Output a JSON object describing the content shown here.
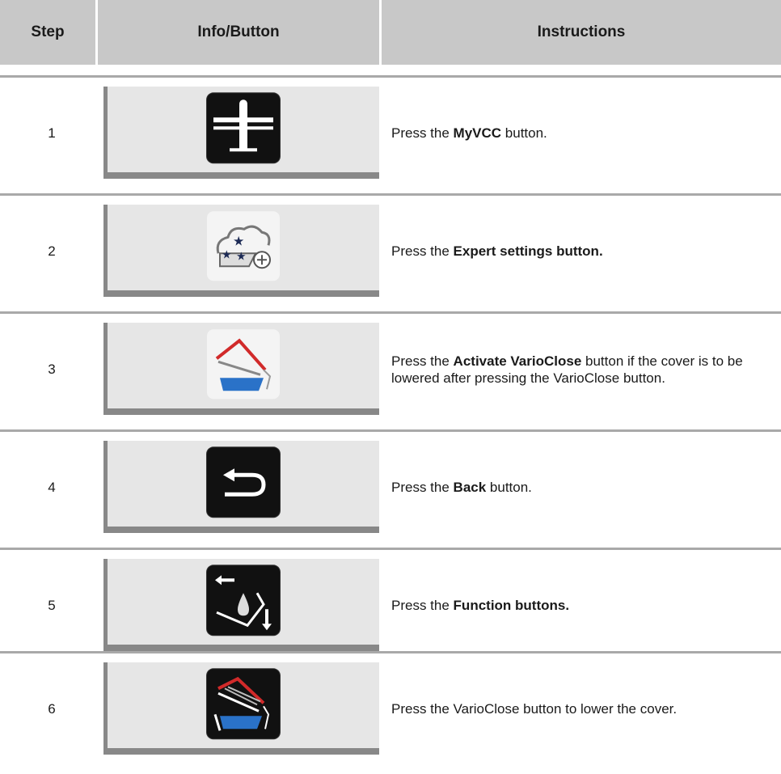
{
  "header": {
    "step": "Step",
    "info": "Info/Button",
    "instructions": "Instructions"
  },
  "rows": [
    {
      "step": "1",
      "icon": "myvcc-icon",
      "pre": "Press the ",
      "bold": "MyVCC",
      "post": " button."
    },
    {
      "step": "2",
      "icon": "expert-settings-icon",
      "pre": "Press the ",
      "bold": "Expert settings button.",
      "post": ""
    },
    {
      "step": "3",
      "icon": "activate-varioclose-icon",
      "pre": "Press the ",
      "bold": "Activate VarioClose",
      "post": " button if the cover is to be lowered after pressing the VarioClose button."
    },
    {
      "step": "4",
      "icon": "back-icon",
      "pre": "Press the ",
      "bold": "Back",
      "post": " button."
    },
    {
      "step": "5",
      "icon": "function-buttons-icon",
      "pre": "Press the ",
      "bold": "Function buttons.",
      "post": ""
    },
    {
      "step": "6",
      "icon": "varioclose-icon",
      "pre": "Press the VarioClose button to lower the cover.",
      "bold": "",
      "post": ""
    }
  ]
}
